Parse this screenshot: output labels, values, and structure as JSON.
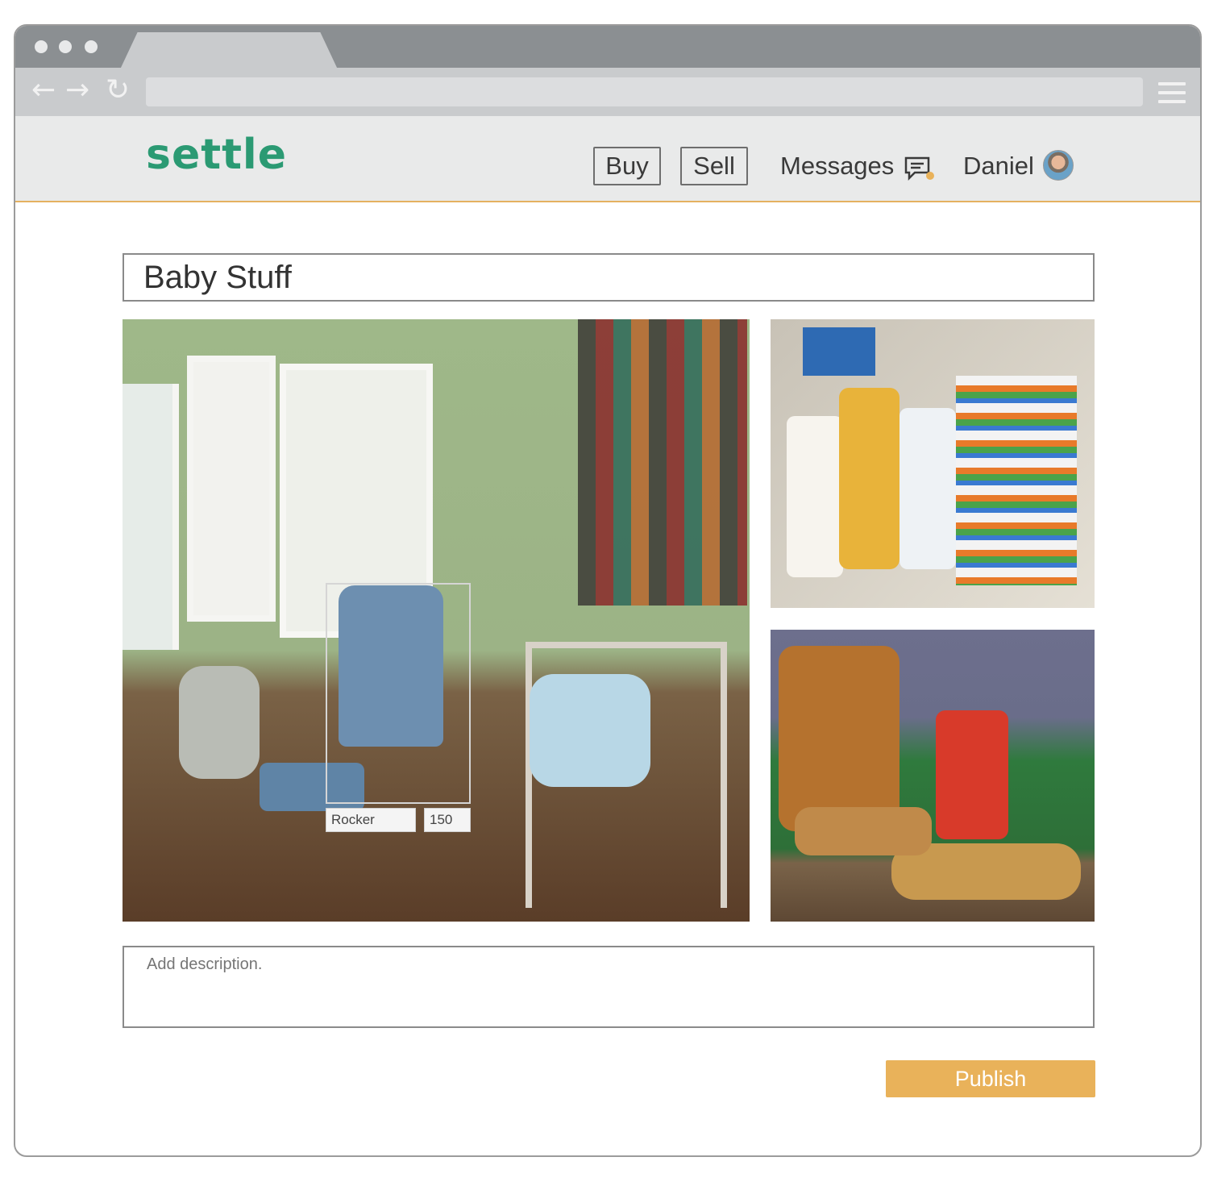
{
  "browser": {
    "icons": [
      "back-arrow-icon",
      "forward-arrow-icon",
      "reload-icon",
      "menu-icon"
    ],
    "back_glyph": "←",
    "forward_glyph": "→",
    "reload_glyph": "↻"
  },
  "header": {
    "logo": "settle",
    "nav": {
      "buy": "Buy",
      "sell": "Sell",
      "messages": "Messages",
      "user": "Daniel"
    },
    "colors": {
      "brand": "#2b9a73",
      "accent": "#e9b25a"
    }
  },
  "listing": {
    "title": "Baby Stuff",
    "description_placeholder": "Add description.",
    "item_tag": {
      "name": "Rocker",
      "price": "150"
    },
    "publish_label": "Publish"
  }
}
